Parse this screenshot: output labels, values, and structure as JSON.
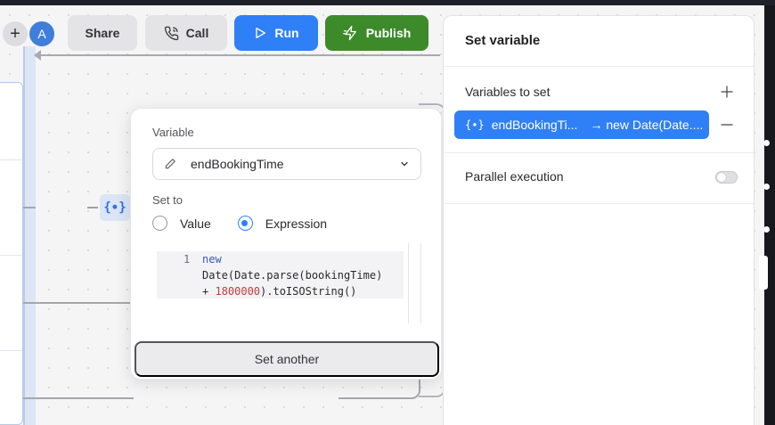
{
  "toolbar": {
    "avatar_initial": "A",
    "share_label": "Share",
    "call_label": "Call",
    "run_label": "Run",
    "publish_label": "Publish"
  },
  "popover": {
    "variable_label": "Variable",
    "variable_value": "endBookingTime",
    "set_to_label": "Set to",
    "option_value": "Value",
    "option_expression": "Expression",
    "selected_option": "Expression",
    "code_line_number": "1",
    "code_line_a": "new",
    "code_line_b": "Date(Date.parse(bookingTime)",
    "code_line_c_op": "+ ",
    "code_line_c_num": "1800000",
    "code_line_c_rest": ").toISOString()",
    "set_another_label": "Set another"
  },
  "panel": {
    "title": "Set variable",
    "variables_to_set_label": "Variables to set",
    "chip_name": "endBookingTi...",
    "chip_value": "→ new Date(Date....",
    "parallel_label": "Parallel execution",
    "parallel_enabled": false
  },
  "colors": {
    "accent_blue": "#2f80f6",
    "publish_green": "#3d8a2a"
  }
}
